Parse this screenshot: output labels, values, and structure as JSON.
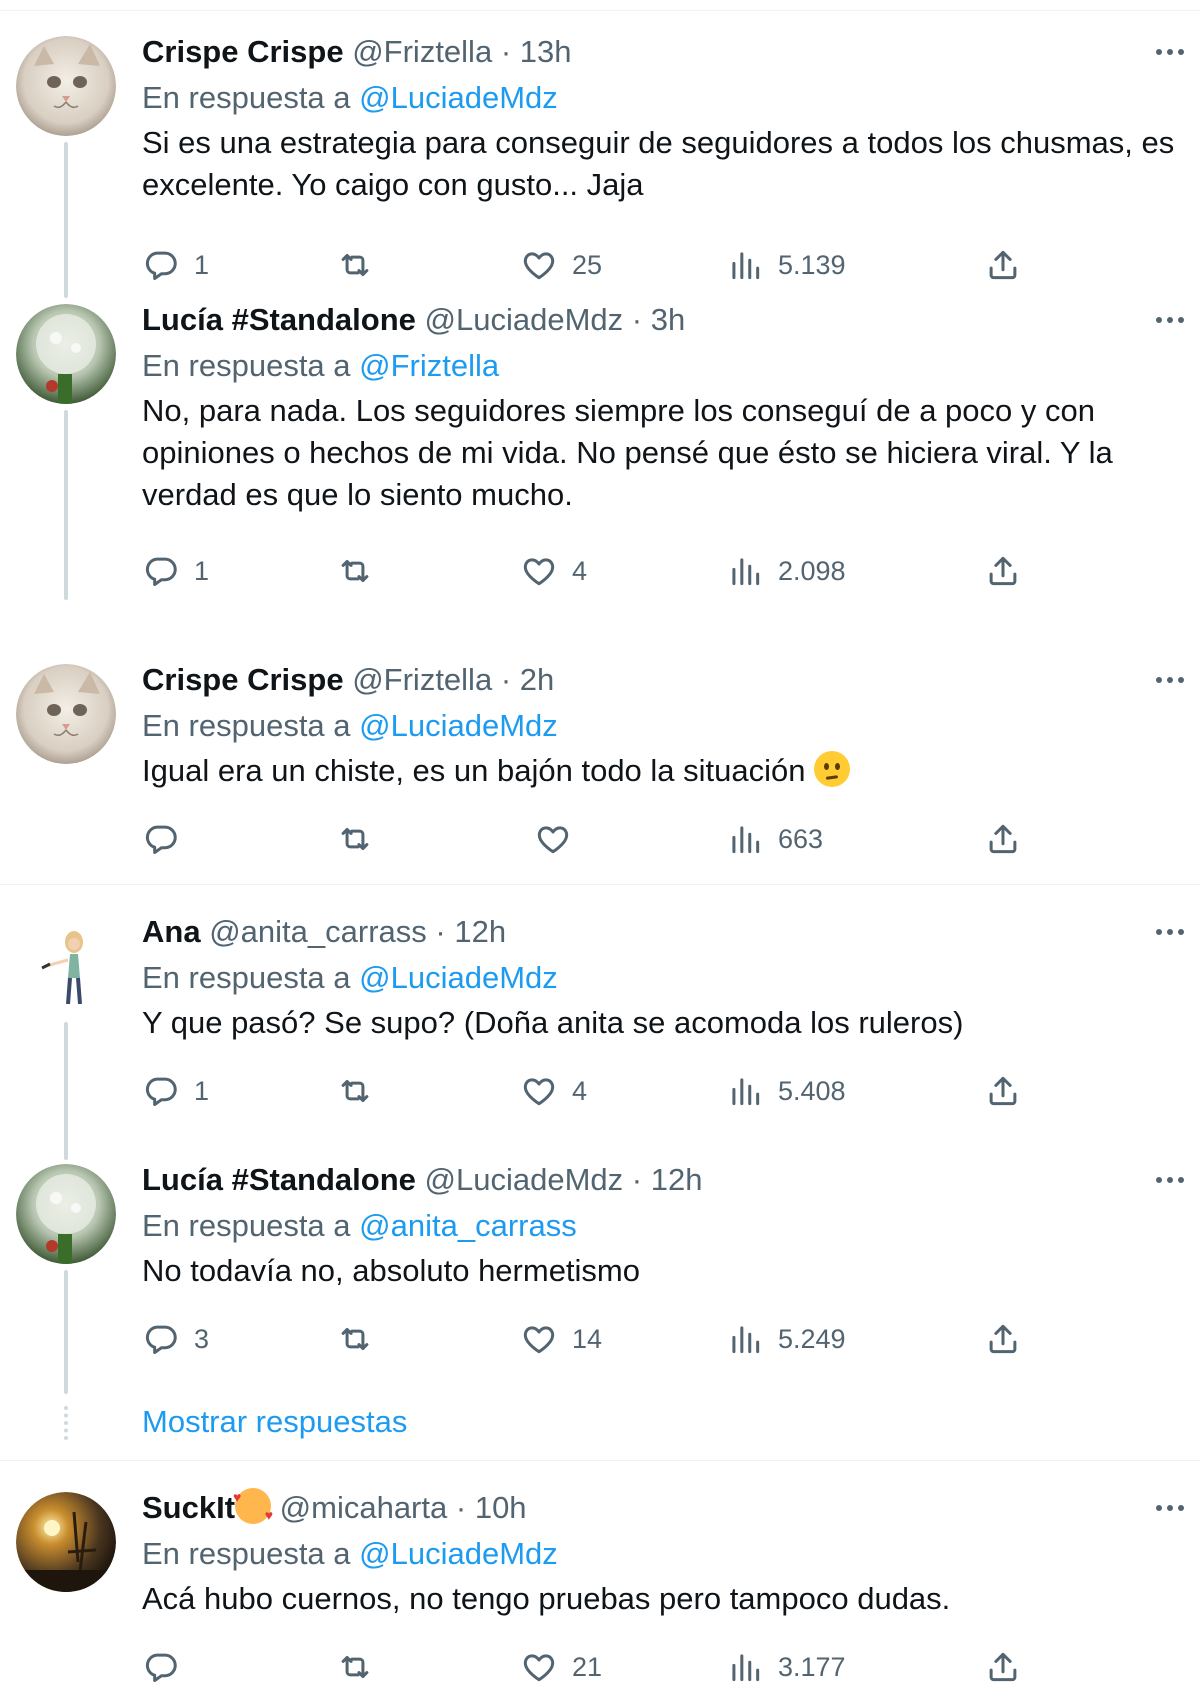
{
  "labels": {
    "replying_to": "En respuesta a",
    "separator": "·"
  },
  "tweets": [
    {
      "name": "Crispe Crispe",
      "handle": "@Friztella",
      "time": "13h",
      "reply_to": "@LuciadeMdz",
      "text": "Si es una estrategia para conseguir de seguidores a todos los chusmas, es excelente. Yo caigo con gusto... Jaja",
      "stats": {
        "replies": "1",
        "retweets": "",
        "likes": "25",
        "views": "5.139"
      },
      "avatar": "cat-avatar"
    },
    {
      "name": "Lucía #Standalone",
      "handle": "@LuciadeMdz",
      "time": "3h",
      "reply_to": "@Friztella",
      "text": "No, para nada. Los seguidores siempre los conseguí de a poco y con opiniones o hechos de mi vida. No pensé que ésto se hiciera viral. Y la verdad es que lo siento mucho.",
      "stats": {
        "replies": "1",
        "retweets": "",
        "likes": "4",
        "views": "2.098"
      },
      "avatar": "flower-avatar"
    },
    {
      "name": "Crispe Crispe",
      "handle": "@Friztella",
      "time": "2h",
      "reply_to": "@LuciadeMdz",
      "text": "Igual era un chiste, es un bajón todo la situación",
      "stats": {
        "replies": "",
        "retweets": "",
        "likes": "",
        "views": "663"
      },
      "avatar": "cat-avatar"
    },
    {
      "name": "Ana",
      "handle": "@anita_carrass",
      "time": "12h",
      "reply_to": "@LuciadeMdz",
      "text": "Y que pasó? Se supo? (Doña anita se acomoda los ruleros)",
      "stats": {
        "replies": "1",
        "retweets": "",
        "likes": "4",
        "views": "5.408"
      },
      "avatar": "bitmoji-avatar"
    },
    {
      "name": "Lucía #Standalone",
      "handle": "@LuciadeMdz",
      "time": "12h",
      "reply_to": "@anita_carrass",
      "text": "No todavía no, absoluto hermetismo",
      "stats": {
        "replies": "3",
        "retweets": "",
        "likes": "14",
        "views": "5.249"
      },
      "avatar": "flower-avatar"
    },
    {
      "name": "SuckIt",
      "handle": "@micaharta",
      "time": "10h",
      "reply_to": "@LuciadeMdz",
      "text": "Acá hubo cuernos, no tengo pruebas pero tampoco dudas.",
      "stats": {
        "replies": "",
        "retweets": "",
        "likes": "21",
        "views": "3.177"
      },
      "avatar": "sunset-avatar"
    }
  ],
  "show_replies": "Mostrar respuestas",
  "colors": {
    "accent": "#1d9bf0",
    "muted": "#536471",
    "text": "#0f1419",
    "divider": "#eff3f4",
    "thread": "#cfd9de"
  },
  "icons": [
    "reply-icon",
    "retweet-icon",
    "like-icon",
    "views-icon",
    "share-icon",
    "more-icon"
  ]
}
